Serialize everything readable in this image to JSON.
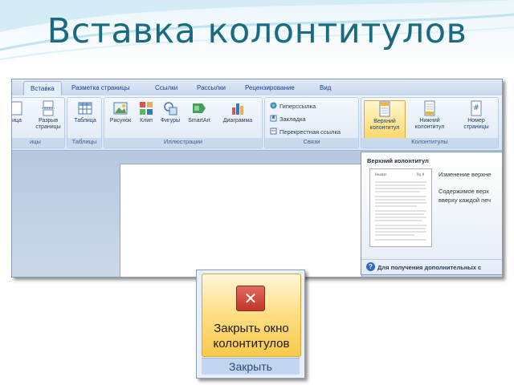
{
  "slide": {
    "title": "Вставка колонтитулов"
  },
  "ribbon": {
    "tabs": [
      {
        "label": "Вставка",
        "active": true
      },
      {
        "label": "Разметка страницы"
      },
      {
        "label": "Ссылки"
      },
      {
        "label": "Рассылки"
      },
      {
        "label": "Рецензирование"
      },
      {
        "label": "Вид"
      }
    ],
    "groups": {
      "pages": {
        "label": "ицы",
        "buttons": [
          "ица",
          "Разрыв страницы"
        ]
      },
      "tables": {
        "label": "Таблицы",
        "buttons": [
          "Таблица"
        ]
      },
      "illustrations": {
        "label": "Иллюстрации",
        "buttons": [
          "Рисунок",
          "Клип",
          "Фигуры",
          "SmartArt",
          "Диаграмма"
        ]
      },
      "links": {
        "label": "Связи",
        "buttons": [
          "Гиперссылка",
          "Закладка",
          "Перекрестная ссылка"
        ]
      },
      "headers": {
        "label": "Колонтитулы",
        "buttons": [
          "Верхний колонтитул",
          "Нижний колонтитул",
          "Номер страницы"
        ]
      }
    },
    "icons": {
      "page_break": "page-break-icon",
      "table": "table-icon",
      "picture": "picture-icon",
      "clip": "clipart-icon",
      "shapes": "shapes-icon",
      "smartart": "smartart-icon",
      "chart": "chart-icon",
      "hyperlink": "hyperlink-icon",
      "bookmark": "bookmark-icon",
      "cross_ref": "cross-reference-icon",
      "header": "header-icon",
      "footer": "footer-icon",
      "page_number": "page-number-icon"
    }
  },
  "tooltip": {
    "title": "Верхний колонтитул",
    "line1": "Изменение верхне",
    "line2": "Содержимое верх",
    "line3": "вверху каждой печ",
    "help": "Для получения дополнительных с",
    "thumb_header_left": "Header",
    "thumb_header_right": "Pg #"
  },
  "close_callout": {
    "button_label": "Закрыть окно колонтитулов",
    "group_label": "Закрыть",
    "icon": "close-x-icon"
  },
  "colors": {
    "title": "#1a6b80",
    "highlight": "#ffd86b",
    "close_icon": "#c2362a",
    "ribbon_text": "#15428b"
  }
}
